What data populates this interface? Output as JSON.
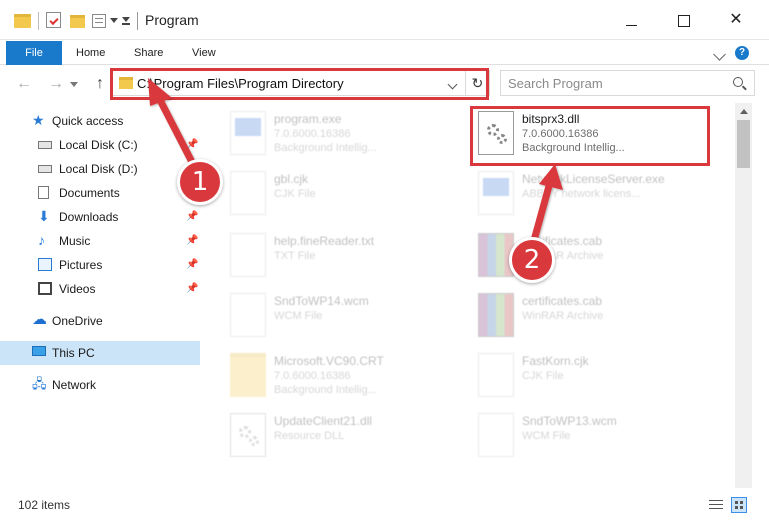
{
  "window": {
    "title": "Program",
    "controls": {
      "minimize": "",
      "maximize": "",
      "close": "✕"
    }
  },
  "ribbon": {
    "tabs": [
      {
        "label": "File"
      },
      {
        "label": "Home"
      },
      {
        "label": "Share"
      },
      {
        "label": "View"
      }
    ],
    "help": "?"
  },
  "navigation": {
    "back": "←",
    "forward": "→",
    "up": "↑",
    "address": "C:\\Program Files\\Program Directory",
    "refresh": "↻",
    "search_placeholder": "Search Program"
  },
  "sidebar": {
    "items": [
      {
        "label": "Quick access",
        "icon": "star-icon"
      },
      {
        "label": "Local Disk (C:)",
        "icon": "disk-icon",
        "pinned": true
      },
      {
        "label": "Local Disk (D:)",
        "icon": "disk-icon"
      },
      {
        "label": "Documents",
        "icon": "documents-icon"
      },
      {
        "label": "Downloads",
        "icon": "download-icon",
        "pinned": true
      },
      {
        "label": "Music",
        "icon": "music-icon",
        "pinned": true
      },
      {
        "label": "Pictures",
        "icon": "pictures-icon",
        "pinned": true
      },
      {
        "label": "Videos",
        "icon": "videos-icon",
        "pinned": true
      },
      {
        "label": "OneDrive",
        "icon": "cloud-icon"
      },
      {
        "label": "This PC",
        "icon": "computer-icon",
        "selected": true
      },
      {
        "label": "Network",
        "icon": "network-icon"
      }
    ]
  },
  "files": [
    {
      "name": "program.exe",
      "line2": "7.0.6000.16386",
      "line3": "Background Intellig...",
      "icon": "application-icon",
      "highlighted": false
    },
    {
      "name": "bitsprx3.dll",
      "line2": "7.0.6000.16386",
      "line3": "Background Intellig...",
      "icon": "dll-gear-icon",
      "highlighted": true
    },
    {
      "name": "gbl.cjk",
      "line2": "CJK File",
      "line3": "",
      "icon": "file-icon",
      "highlighted": false
    },
    {
      "name": "NetworkLicenseServer.exe",
      "line2": "ABBYY network licens...",
      "line3": "",
      "icon": "application-icon",
      "highlighted": false
    },
    {
      "name": "help.fineReader.txt",
      "line2": "TXT File",
      "line3": "",
      "icon": "file-icon",
      "highlighted": false
    },
    {
      "name": "certificates.cab",
      "line2": "WinRAR Archive",
      "line3": "",
      "icon": "winrar-icon",
      "highlighted": false
    },
    {
      "name": "SndToWP14.wcm",
      "line2": "WCM File",
      "line3": "",
      "icon": "file-icon",
      "highlighted": false
    },
    {
      "name": "certificates.cab",
      "line2": "WinRAR Archive",
      "line3": "",
      "icon": "winrar-icon",
      "highlighted": false
    },
    {
      "name": "Microsoft.VC90.CRT",
      "line2": "7.0.6000.16386",
      "line3": "Background Intellig...",
      "icon": "folder-icon",
      "highlighted": false
    },
    {
      "name": "FastKorn.cjk",
      "line2": "CJK File",
      "line3": "",
      "icon": "file-icon",
      "highlighted": false
    },
    {
      "name": "UpdateClient21.dll",
      "line2": "Resource DLL",
      "line3": "",
      "icon": "dll-gear-icon",
      "highlighted": false
    },
    {
      "name": "SndToWP13.wcm",
      "line2": "WCM File",
      "line3": "",
      "icon": "file-icon",
      "highlighted": false
    }
  ],
  "status": {
    "item_count": "102 items"
  },
  "callouts": [
    {
      "number": "1",
      "target": "address-bar"
    },
    {
      "number": "2",
      "target": "bitsprx3.dll"
    }
  ],
  "colors": {
    "accent": "#1979ca",
    "highlight_red": "#d9383c",
    "selection": "#cce4f7"
  }
}
